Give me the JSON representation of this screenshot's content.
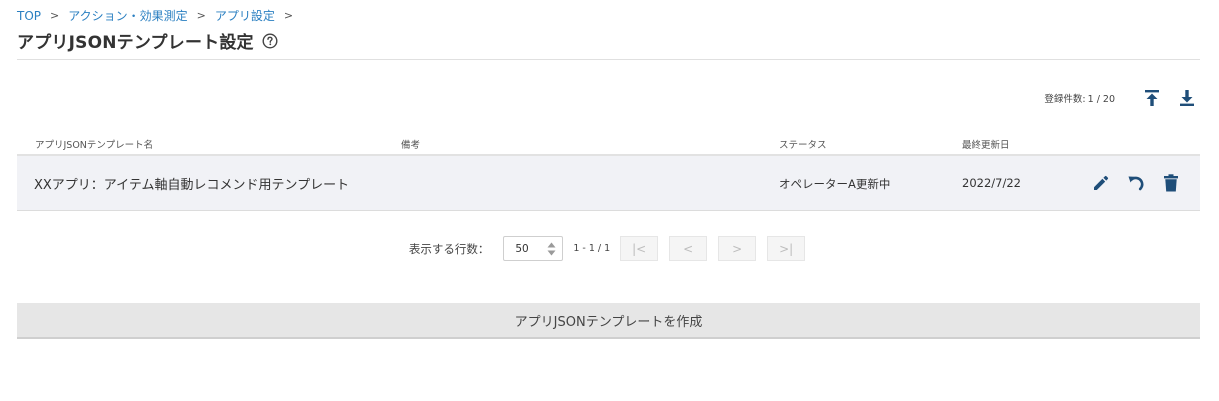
{
  "breadcrumb": {
    "items": [
      "TOP",
      "アクション・効果測定",
      "アプリ設定"
    ],
    "separator": ">"
  },
  "page": {
    "title": "アプリJSONテンプレート設定",
    "help_icon": "question-circle-icon"
  },
  "summary": {
    "count_label": "登録件数:",
    "count_value": "1 / 20",
    "upload_icon": "upload-icon",
    "download_icon": "download-icon"
  },
  "table": {
    "columns": [
      "アプリJSONテンプレート名",
      "備考",
      "ステータス",
      "最終更新日"
    ],
    "rows": [
      {
        "name": "XXアプリ：アイテム軸自動レコメンド用テンプレート",
        "note": "",
        "status": "オペレーターA更新中",
        "updated": "2022/7/22",
        "actions": [
          "edit-icon",
          "undo-icon",
          "delete-icon"
        ]
      }
    ]
  },
  "pagination": {
    "rows_label": "表示する行数：",
    "rows_value": "50",
    "range": "1 - 1 / 1",
    "first": "|<",
    "prev": "<",
    "next": ">",
    "last": ">|"
  },
  "create_button": {
    "label": "アプリJSONテンプレートを作成"
  },
  "colors": {
    "link": "#2a7fc1",
    "icon": "#1f4e79",
    "row_bg": "#f1f2f6",
    "button_bg": "#e6e6e6"
  }
}
